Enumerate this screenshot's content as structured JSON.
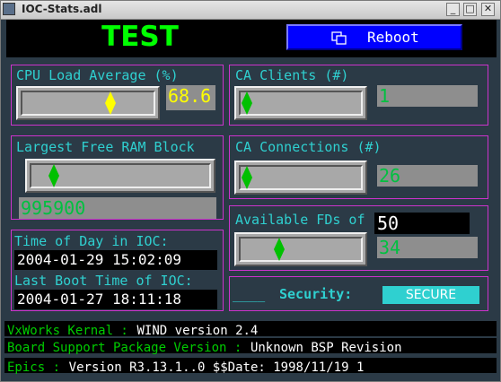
{
  "window": {
    "title": "IOC-Stats.adl",
    "minimize_glyph": "_",
    "maximize_glyph": "□",
    "close_glyph": "✕"
  },
  "header": {
    "ioc_name": "TEST",
    "reboot_label": "Reboot",
    "reboot_icon": "windows-icon"
  },
  "cpu": {
    "label": "CPU Load Average (%)",
    "value": "68.6",
    "fraction": 0.69,
    "indicator_color": "#ffff00"
  },
  "ram": {
    "label": "Largest Free RAM Block",
    "value": "995900",
    "fraction": 0.1,
    "indicator_color": "#00c000"
  },
  "time_of_day": {
    "label": "Time of Day in IOC:",
    "value": "2004-01-29 15:02:09"
  },
  "last_boot": {
    "label": "Last Boot Time of IOC:",
    "value": "2004-01-27 18:11:18"
  },
  "ca_clients": {
    "label": "CA Clients (#)",
    "value": "1",
    "fraction": 0.0,
    "indicator_color": "#00c000"
  },
  "ca_connections": {
    "label": "CA Connections (#)",
    "value": "26",
    "fraction": 0.0,
    "indicator_color": "#00c000"
  },
  "fds": {
    "label": "Available FDs of",
    "total": "50",
    "value": "34",
    "fraction": 0.3,
    "indicator_color": "#00c000"
  },
  "security": {
    "blank": "____",
    "label": "Security:",
    "status": "SECURE"
  },
  "info": {
    "vxworks_label": "VxWorks Kernal :",
    "vxworks_value": "WIND version 2.4",
    "bsp_label": "Board Support Package Version :",
    "bsp_value": "Unknown BSP Revision",
    "epics_label": "Epics :",
    "epics_value": "Version R3.13.1..0 $$Date: 1998/11/19 1"
  },
  "colors": {
    "background": "#2b3a46",
    "panel_border": "#cc33cc",
    "label": "#2fd0d0",
    "ioc_name": "#00ff00",
    "cpu_value": "#ffff00",
    "ca_value": "#00c040",
    "reboot_bg": "#0000ff",
    "secure_bg": "#2fd0d0"
  }
}
